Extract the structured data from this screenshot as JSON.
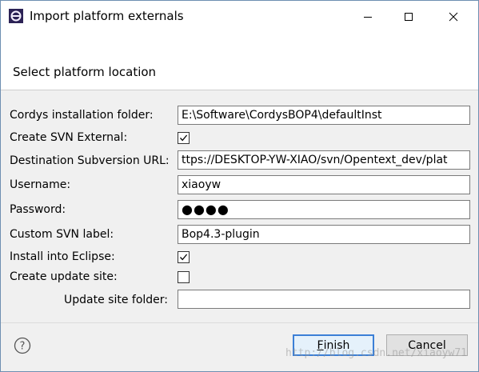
{
  "window": {
    "title": "Import platform externals",
    "app_icon": "eclipse-icon",
    "controls": [
      "minimize-icon",
      "maximize-icon",
      "close-icon"
    ]
  },
  "header": {
    "title": "Select platform location"
  },
  "form": {
    "installation_folder": {
      "label": "Cordys installation folder:",
      "value": "E:\\Software\\CordysBOP4\\defaultInst"
    },
    "create_svn_external": {
      "label": "Create SVN External:",
      "checked": true
    },
    "destination_url": {
      "label": "Destination Subversion URL:",
      "value": "ttps://DESKTOP-YW-XIAO/svn/Opentext_dev/plat"
    },
    "username": {
      "label": "Username:",
      "value": "xiaoyw"
    },
    "password": {
      "label": "Password:",
      "value": "●●●●"
    },
    "custom_svn_label": {
      "label": "Custom SVN label:",
      "value": "Bop4.3-plugin"
    },
    "install_into_eclipse": {
      "label": "Install into Eclipse:",
      "checked": true
    },
    "create_update_site": {
      "label": "Create update site:",
      "checked": false
    },
    "update_site_folder": {
      "label": "Update site folder:",
      "value": ""
    }
  },
  "footer": {
    "help_icon": "help-icon",
    "finish_label_mnemonic": "F",
    "finish_label_rest": "inish",
    "cancel_label": "Cancel"
  },
  "watermark": "http://blog.csdn.net/xiaoyw71"
}
